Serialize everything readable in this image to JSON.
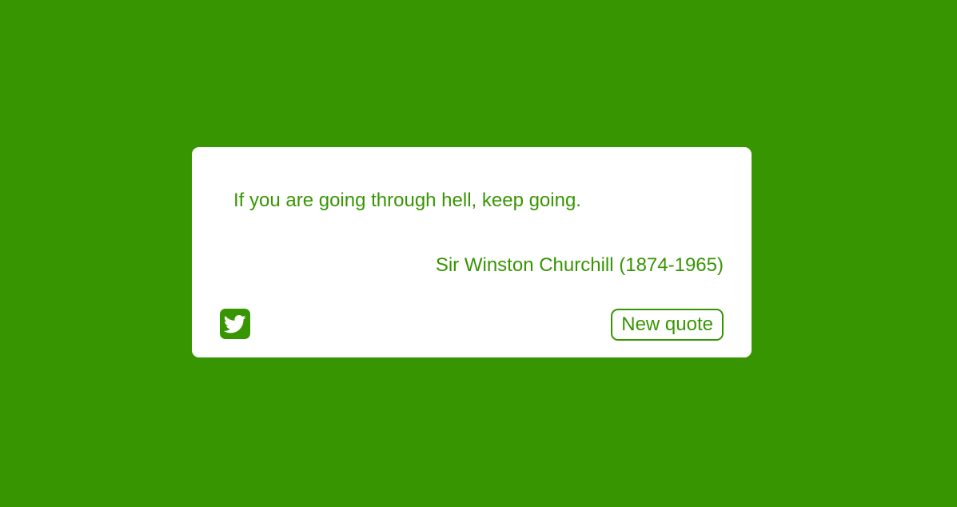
{
  "colors": {
    "background": "#389502",
    "card": "#ffffff",
    "accent": "#389502"
  },
  "quote": {
    "text": "If you are going through hell, keep going.",
    "author": "Sir Winston Churchill (1874-1965)"
  },
  "actions": {
    "tweet_icon": "twitter-icon",
    "new_quote_label": "New quote"
  }
}
